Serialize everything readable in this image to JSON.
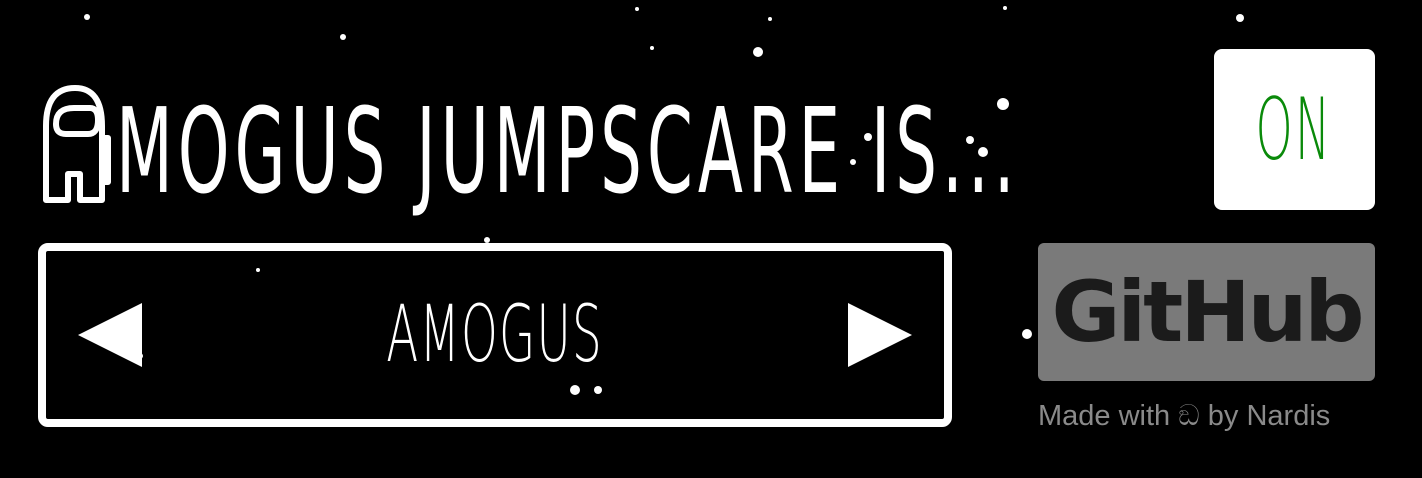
{
  "title": {
    "icon": "crewmate-icon",
    "text": "MOGUS JUMPSCARE IS..."
  },
  "toggle": {
    "label": "ON",
    "color": "#0a8a0a"
  },
  "selector": {
    "value": "AMOGUS",
    "prev_icon": "triangle-left-icon",
    "next_icon": "triangle-right-icon"
  },
  "github": {
    "label": "GitHub"
  },
  "footer": {
    "made_with": "Made with",
    "heart_glyph": "ඞ",
    "by": "by Nardis"
  },
  "colors": {
    "background": "#000000",
    "foreground": "#ffffff",
    "github_bg": "#7a7a7a",
    "credit_text": "#8a8a8a"
  }
}
